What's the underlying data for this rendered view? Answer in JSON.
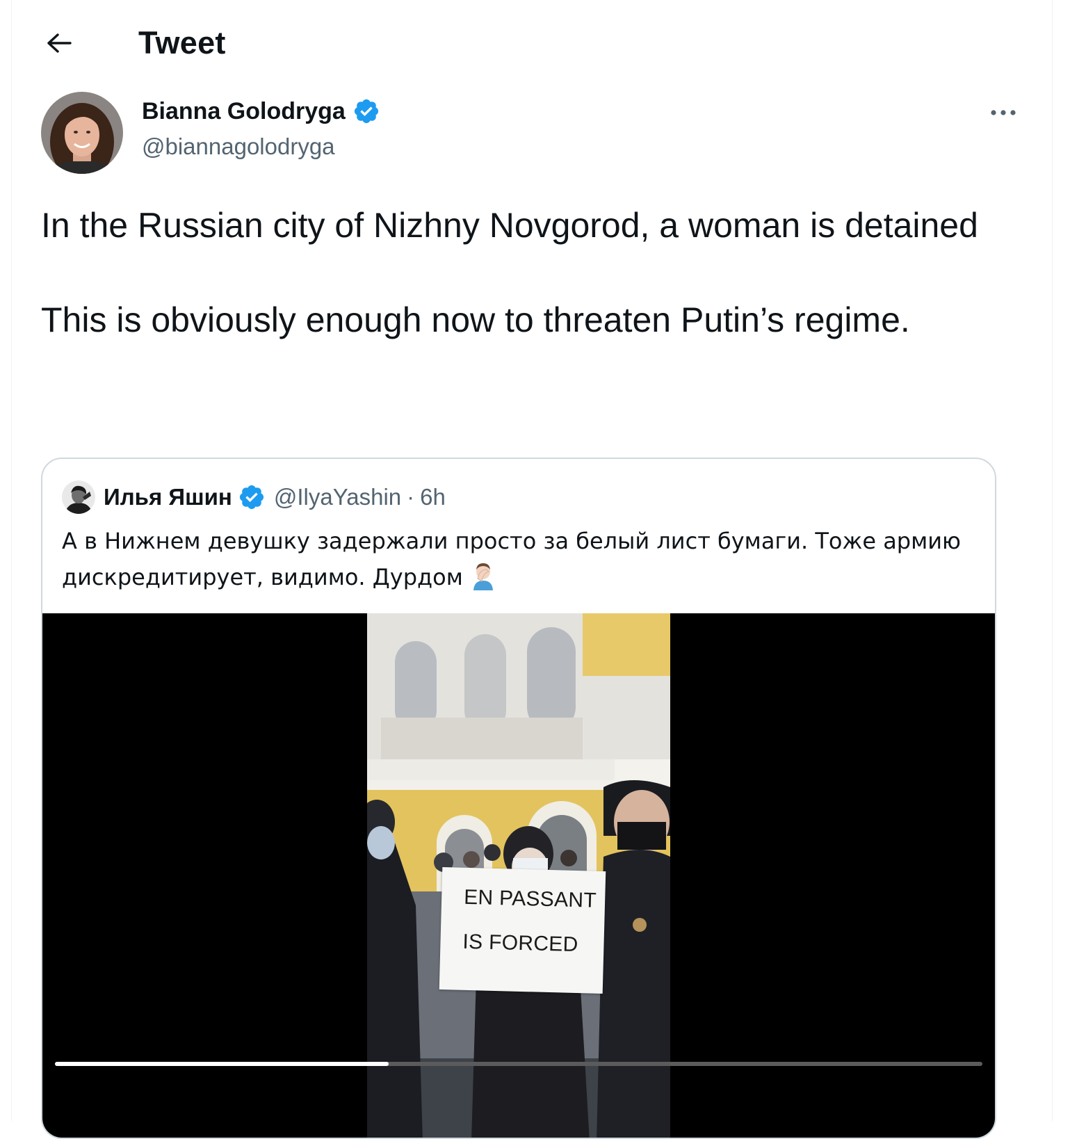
{
  "header": {
    "title": "Tweet",
    "back_icon": "arrow-left-icon"
  },
  "tweet": {
    "author": {
      "name": "Bianna Golodryga",
      "handle": "@biannagolodryga",
      "verified": true
    },
    "text": "In the Russian city of Nizhny Novgorod, a woman is detained\n\nThis is obviously enough now to threaten Putin’s regime.",
    "more_icon": "ellipsis-icon"
  },
  "quote": {
    "author": {
      "name": "Илья Яшин",
      "handle": "@IlyaYashin",
      "separator": "·",
      "time": "6h",
      "verified": true
    },
    "text": "А в Нижнем девушку задержали просто за белый лист бумаги. Тоже армию дискредитирует, видимо. Дурдом",
    "emoji": "man-facepalming-emoji",
    "media": {
      "sign_line_1": "EN PASSANT",
      "sign_line_2": "IS FORCED",
      "progress": 0.36
    }
  },
  "colors": {
    "verified_blue": "#1d9bf0",
    "text_primary": "#0f1419",
    "text_secondary": "#536471",
    "border": "#cfd9de"
  }
}
